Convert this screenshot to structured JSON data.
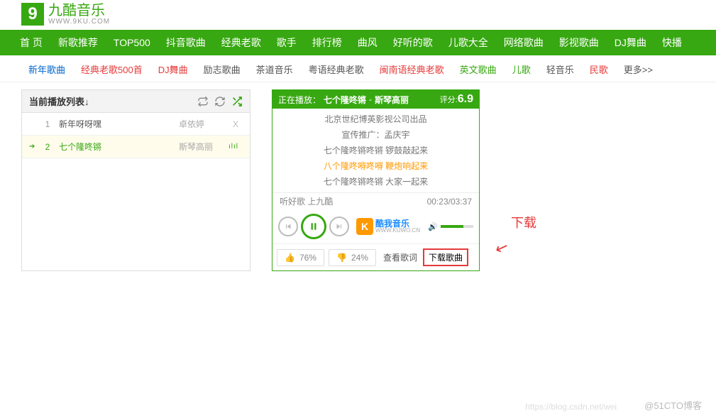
{
  "logo": {
    "letter": "9",
    "text": "九酷音乐",
    "sub": "WWW.9KU.COM"
  },
  "nav": [
    "首 页",
    "新歌推荐",
    "TOP500",
    "抖音歌曲",
    "经典老歌",
    "歌手",
    "排行榜",
    "曲风",
    "好听的歌",
    "儿歌大全",
    "网络歌曲",
    "影视歌曲",
    "DJ舞曲",
    "快播"
  ],
  "tags": [
    {
      "t": "新年歌曲",
      "c": "tag-blue"
    },
    {
      "t": "经典老歌500首",
      "c": "tag-red"
    },
    {
      "t": "DJ舞曲",
      "c": "tag-red"
    },
    {
      "t": "励志歌曲",
      "c": "tag-gray"
    },
    {
      "t": "茶道音乐",
      "c": "tag-gray"
    },
    {
      "t": "粤语经典老歌",
      "c": "tag-gray"
    },
    {
      "t": "闽南语经典老歌",
      "c": "tag-red"
    },
    {
      "t": "英文歌曲",
      "c": "tag-green"
    },
    {
      "t": "儿歌",
      "c": "tag-green"
    },
    {
      "t": "轻音乐",
      "c": "tag-gray"
    },
    {
      "t": "民歌",
      "c": "tag-red"
    },
    {
      "t": "更多>>",
      "c": "tag-gray"
    }
  ],
  "playlist": {
    "title": "当前播放列表↓",
    "items": [
      {
        "idx": "1",
        "title": "新年呀呀嘿",
        "artist": "卓依婷",
        "active": false
      },
      {
        "idx": "2",
        "title": "七个隆咚锵",
        "artist": "斯琴高丽",
        "active": true
      }
    ]
  },
  "player": {
    "nowLabel": "正在播放：",
    "song": "七个隆咚锵",
    "sep": " - ",
    "artist": "斯琴高丽",
    "ratingLabel": "评分:",
    "rating": "6.9",
    "lyrics": [
      "北京世纪博英影视公司出品",
      "宣传推广：孟庆宇",
      "七个隆咚锵咚锵 锣鼓敲起来",
      "八个隆咚嘚咚嘚 鞭炮响起来",
      "七个隆咚锵咚锵 大家一起来"
    ],
    "hlIndex": 3,
    "slogan": "听好歌 上九酷",
    "time": "00:23/03:37",
    "kuwo": {
      "cn": "酷我音乐",
      "en": "WWW.KUWO.CN"
    },
    "likePct": "76%",
    "dislikePct": "24%",
    "viewLyrics": "查看歌词",
    "download": "下载歌曲"
  },
  "annotation": "下载",
  "watermark1": "@51CTO博客",
  "watermark2": "https://blog.csdn.net/wei"
}
